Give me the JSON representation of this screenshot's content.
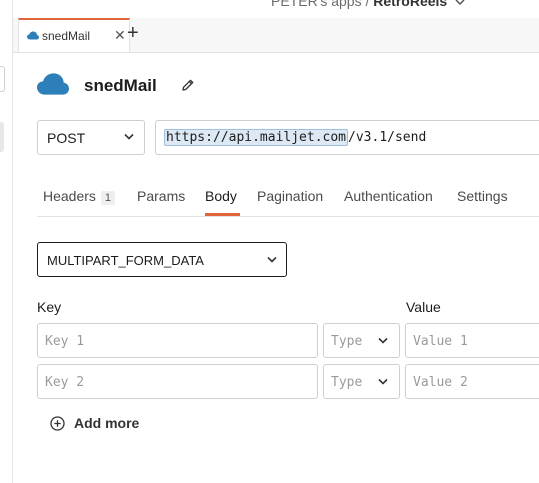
{
  "breadcrumb": {
    "workspace": "PETER's apps",
    "separator": "/",
    "app": "RetroReels"
  },
  "tab": {
    "label": "snedMail",
    "close": "✕",
    "icon": "cloud-icon"
  },
  "new_tab": "+",
  "query": {
    "name": "snedMail",
    "icon": "cloud-icon",
    "edit_icon": "pencil-icon"
  },
  "request": {
    "method": "POST",
    "url_highlight": "https://api.mailjet.com",
    "url_rest": "/v3.1/send"
  },
  "subtabs": [
    {
      "label": "Headers",
      "badge": "1"
    },
    {
      "label": "Params"
    },
    {
      "label": "Body"
    },
    {
      "label": "Pagination"
    },
    {
      "label": "Authentication"
    },
    {
      "label": "Settings"
    }
  ],
  "active_subtab": "Body",
  "body": {
    "type": "MULTIPART_FORM_DATA",
    "columns": {
      "key": "Key",
      "value": "Value"
    },
    "rows": [
      {
        "key_placeholder": "Key 1",
        "type_placeholder": "Type",
        "value_placeholder": "Value 1"
      },
      {
        "key_placeholder": "Key 2",
        "type_placeholder": "Type",
        "value_placeholder": "Value 2"
      }
    ],
    "add_more": "Add more"
  },
  "colors": {
    "accent": "#e2663b",
    "cloud": "#2c7fb8",
    "highlight": "#dce9f5"
  }
}
